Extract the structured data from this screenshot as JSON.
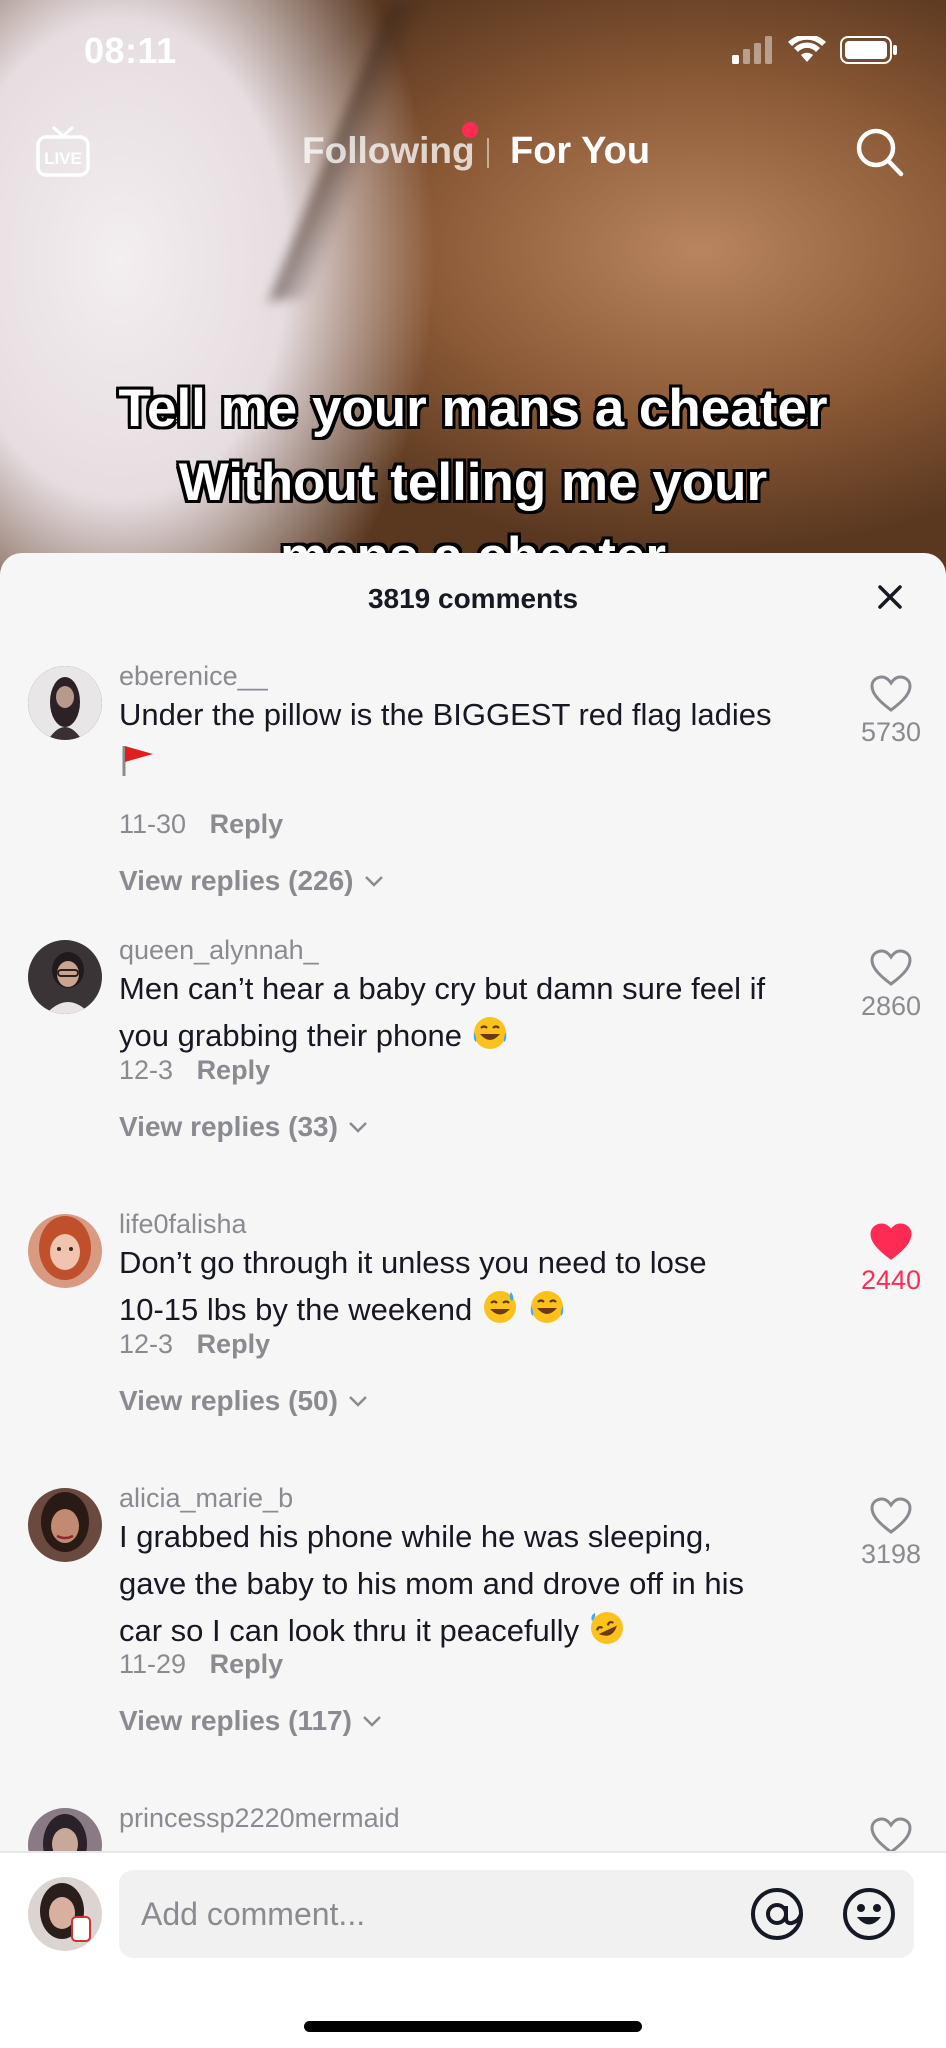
{
  "status_bar": {
    "time": "08:11"
  },
  "top_nav": {
    "live_label": "LIVE",
    "tab_following": "Following",
    "tab_for_you": "For You"
  },
  "video": {
    "caption_lines": [
      "Tell me your mans a cheater",
      "Without telling me your",
      "mans a cheater"
    ]
  },
  "comments_sheet": {
    "title": "3819 comments",
    "comments": [
      {
        "username": "eberenice__",
        "text": "Under the pillow is the BIGGEST red flag ladies",
        "date": "11-30",
        "reply": "Reply",
        "view_replies": "View replies (226)",
        "likes": "5730",
        "liked": false
      },
      {
        "username": "queen_alynnah_",
        "text_line1": "Men can’t hear a baby cry but damn sure feel if",
        "text_line2": "you grabbing their phone",
        "date": "12-3",
        "reply": "Reply",
        "view_replies": "View replies (33)",
        "likes": "2860",
        "liked": false
      },
      {
        "username": "life0falisha",
        "text_line1": "Don’t go through it unless you need to lose",
        "text_line2": "10-15 lbs by the weekend",
        "date": "12-3",
        "reply": "Reply",
        "view_replies": "View replies (50)",
        "likes": "2440",
        "liked": true
      },
      {
        "username": "alicia_marie_b",
        "text_line1": "I grabbed his phone while he was sleeping,",
        "text_line2": "gave the baby to his mom and drove off in his",
        "text_line3": "car so I can look thru it peacefully",
        "date": "11-29",
        "reply": "Reply",
        "view_replies": "View replies (117)",
        "likes": "3198",
        "liked": false
      },
      {
        "username": "princessp2220mermaid"
      }
    ]
  },
  "input": {
    "placeholder": "Add comment..."
  },
  "colors": {
    "accent": "#fe2c55",
    "muted": "#8a8b91",
    "text": "#161823"
  }
}
